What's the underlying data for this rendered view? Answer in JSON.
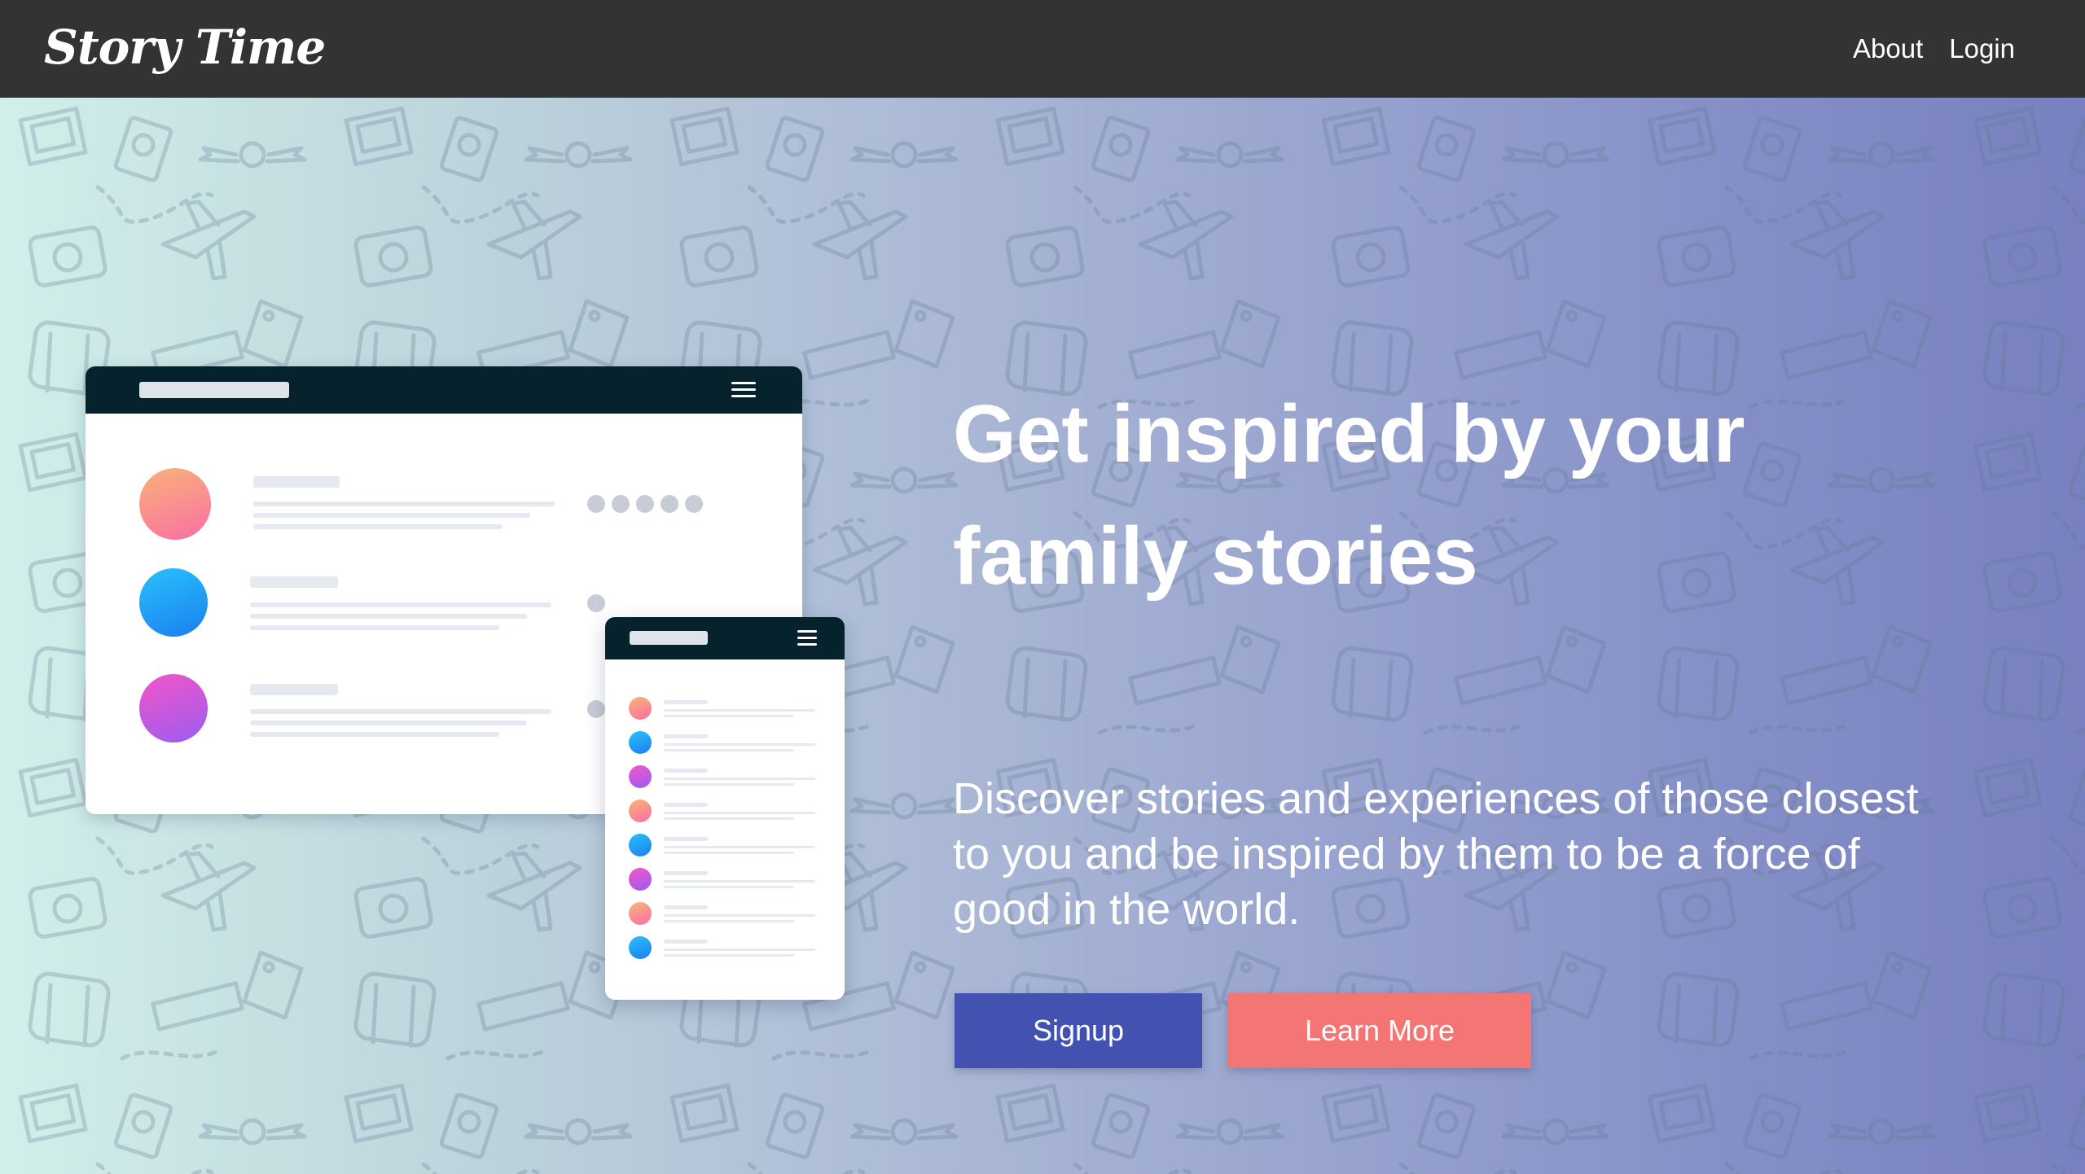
{
  "navbar": {
    "brand": "Story Time",
    "links": [
      {
        "label": "About"
      },
      {
        "label": "Login"
      }
    ]
  },
  "hero": {
    "title": "Get inspired by your family stories",
    "subtitle": "Discover stories and experiences of those closest to you and be inspired by them to be a force of good in the world.",
    "buttons": {
      "signup": "Signup",
      "learn_more": "Learn More"
    },
    "background_pattern_icons": [
      "airplane-icon",
      "camera-icon",
      "suitcase-icon",
      "passport-icon",
      "luggage-tag-icon",
      "fragile-stamp-icon",
      "winged-globe-icon",
      "photo-icon"
    ]
  },
  "colors": {
    "navbar": "#333333",
    "gradient_start": "#d2efea",
    "gradient_end": "#7880bf",
    "signup_button": "#4352b0",
    "learn_more_button": "#f37674",
    "illustration_header": "#06222c"
  }
}
